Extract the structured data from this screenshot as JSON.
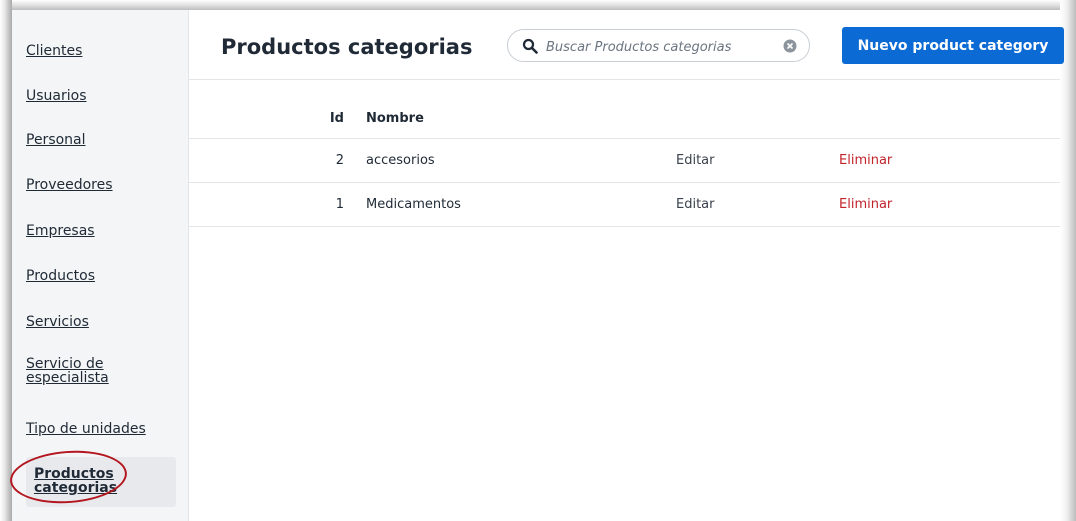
{
  "sidebar": {
    "items": [
      {
        "label": "Clientes"
      },
      {
        "label": "Usuarios"
      },
      {
        "label": "Personal"
      },
      {
        "label": "Proveedores"
      },
      {
        "label": "Empresas"
      },
      {
        "label": "Productos"
      },
      {
        "label": "Servicios"
      },
      {
        "label": "Servicio de especialista"
      },
      {
        "label": "Tipo de unidades"
      },
      {
        "label": "Productos categorias",
        "active": true
      }
    ]
  },
  "header": {
    "title": "Productos categorias",
    "search_placeholder": "Buscar Productos categorias",
    "new_button_label": "Nuevo product category"
  },
  "table": {
    "columns": {
      "id": "Id",
      "name": "Nombre"
    },
    "rows": [
      {
        "id": "2",
        "name": "accesorios",
        "edit": "Editar",
        "delete": "Eliminar"
      },
      {
        "id": "1",
        "name": "Medicamentos",
        "edit": "Editar",
        "delete": "Eliminar"
      }
    ]
  },
  "colors": {
    "primary": "#0c6ad4",
    "danger": "#c2232b",
    "annotation_circle": "#b3161f",
    "sidebar_bg": "#f4f5f6"
  },
  "icons": {
    "search": "search-icon",
    "clear": "clear-circle-icon"
  }
}
